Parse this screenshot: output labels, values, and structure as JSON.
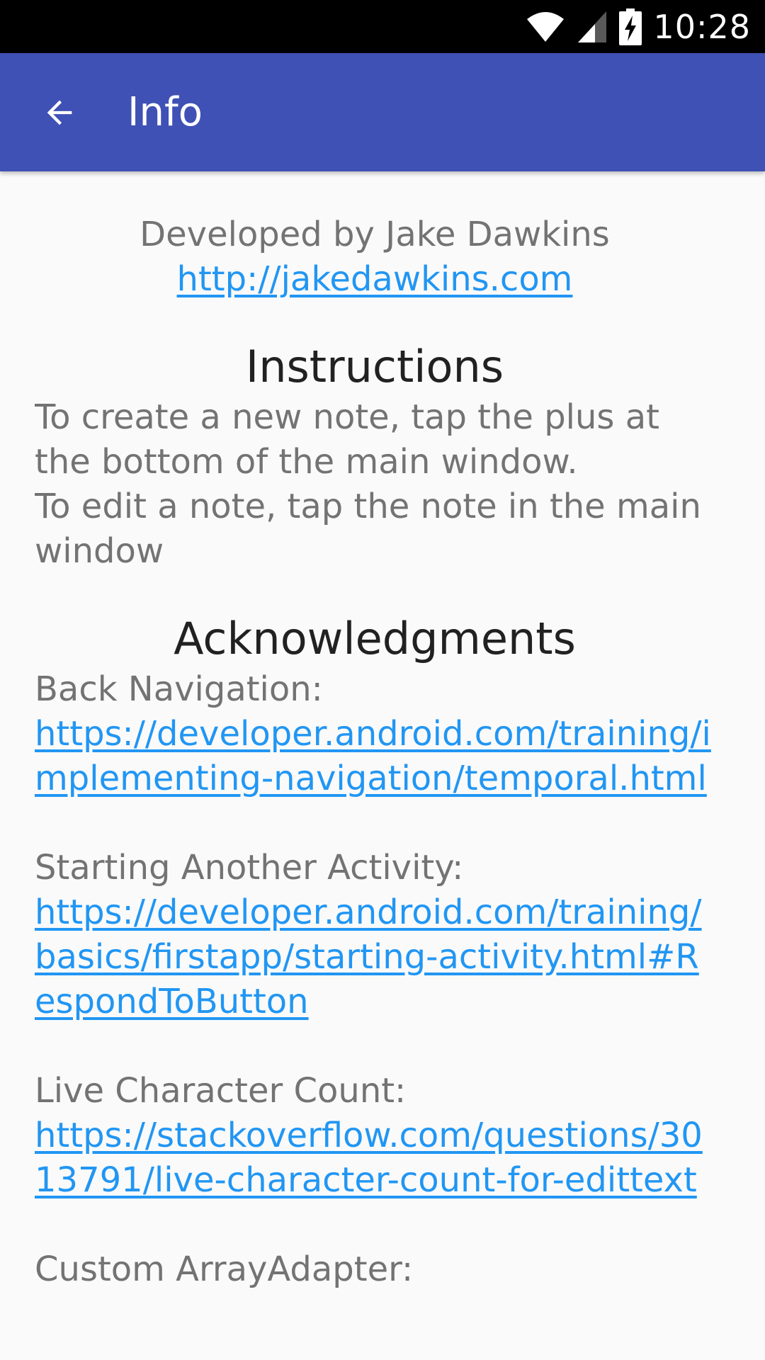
{
  "status_bar": {
    "time": "10:28",
    "icons": [
      "wifi-icon",
      "cellular-signal-icon",
      "battery-charging-icon"
    ]
  },
  "app_bar": {
    "title": "Info",
    "back_icon": "arrow-back-icon",
    "color": "#3f51b5"
  },
  "credit": {
    "text": "Developed by Jake Dawkins",
    "link": "http://jakedawkins.com"
  },
  "instructions": {
    "heading": "Instructions",
    "line1": "To create a new note, tap the plus at the bottom of the main window.",
    "line2": "To edit a note, tap the note in the main window"
  },
  "acknowledgments": {
    "heading": "Acknowledgments",
    "items": [
      {
        "label": "Back Navigation:",
        "url": "https://developer.android.com/training/implementing-navigation/temporal.html"
      },
      {
        "label": "Starting Another Activity:",
        "url": "https://developer.android.com/training/basics/firstapp/starting-activity.html#RespondToButton"
      },
      {
        "label": "Live Character Count:",
        "url": "https://stackoverflow.com/questions/3013791/live-character-count-for-edittext"
      },
      {
        "label": "Custom ArrayAdapter:",
        "url": ""
      }
    ]
  },
  "colors": {
    "link": "#2196f3",
    "body_text": "#737373",
    "heading": "#212121",
    "background": "#fafafa"
  }
}
